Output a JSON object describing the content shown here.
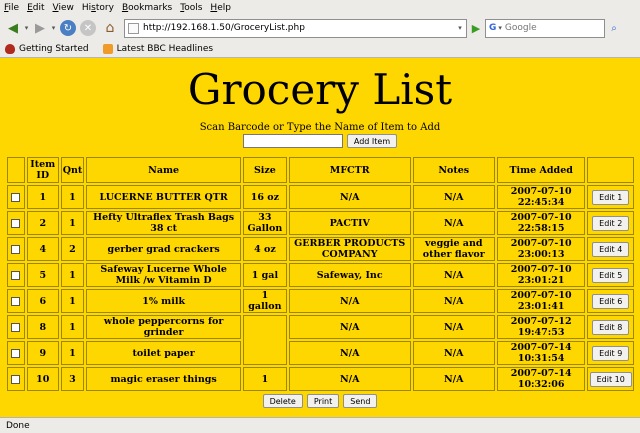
{
  "menu": [
    "File",
    "Edit",
    "View",
    "History",
    "Bookmarks",
    "Tools",
    "Help"
  ],
  "menu_accel": [
    "F",
    "E",
    "V",
    "s",
    "B",
    "T",
    "H"
  ],
  "nav": {
    "url": "http://192.168.1.50/GroceryList.php",
    "search_placeholder": "Google",
    "search_engine_icon": "G"
  },
  "bookmarks": [
    {
      "label": "Getting Started",
      "icon": "firefox-icon"
    },
    {
      "label": "Latest BBC Headlines",
      "icon": "rss-feed-icon"
    }
  ],
  "page": {
    "title": "Grocery List",
    "prompt": "Scan Barcode or Type the Name of Item to Add",
    "add_button": "Add Item",
    "background": "#ffd700"
  },
  "table": {
    "headers": [
      "",
      "Item ID",
      "Qnt",
      "Name",
      "Size",
      "MFCTR",
      "Notes",
      "Time Added",
      ""
    ],
    "rows": [
      {
        "id": "1",
        "qnt": "1",
        "name": "LUCERNE BUTTER QTR",
        "size": "16 oz",
        "mfctr": "N/A",
        "notes": "N/A",
        "time": "2007-07-10 22:45:34",
        "edit": "Edit 1"
      },
      {
        "id": "2",
        "qnt": "1",
        "name": "Hefty Ultraflex Trash Bags 38 ct",
        "size": "33 Gallon",
        "mfctr": "PACTIV",
        "notes": "N/A",
        "time": "2007-07-10 22:58:15",
        "edit": "Edit 2"
      },
      {
        "id": "4",
        "qnt": "2",
        "name": "gerber grad crackers",
        "size": "4 oz",
        "mfctr": "GERBER PRODUCTS COMPANY",
        "notes": "veggie and other flavor",
        "time": "2007-07-10 23:00:13",
        "edit": "Edit 4"
      },
      {
        "id": "5",
        "qnt": "1",
        "name": "Safeway Lucerne Whole Milk /w Vitamin D",
        "size": "1 gal",
        "mfctr": "Safeway, Inc",
        "notes": "N/A",
        "time": "2007-07-10 23:01:21",
        "edit": "Edit 5"
      },
      {
        "id": "6",
        "qnt": "1",
        "name": "1% milk",
        "size": "1 gallon",
        "mfctr": "N/A",
        "notes": "N/A",
        "time": "2007-07-10 23:01:41",
        "edit": "Edit 6"
      },
      {
        "id": "8",
        "qnt": "1",
        "name": "whole peppercorns for grinder",
        "size": "",
        "mfctr": "N/A",
        "notes": "N/A",
        "time": "2007-07-12 19:47:53",
        "edit": "Edit 8"
      },
      {
        "id": "9",
        "qnt": "1",
        "name": "toilet paper",
        "size": "",
        "mfctr": "N/A",
        "notes": "N/A",
        "time": "2007-07-14 10:31:54",
        "edit": "Edit 9"
      },
      {
        "id": "10",
        "qnt": "3",
        "name": "magic eraser things",
        "size": "1",
        "mfctr": "N/A",
        "notes": "N/A",
        "time": "2007-07-14 10:32:06",
        "edit": "Edit 10"
      }
    ]
  },
  "actions": [
    "Delete",
    "Print",
    "Send"
  ],
  "status": "Done"
}
